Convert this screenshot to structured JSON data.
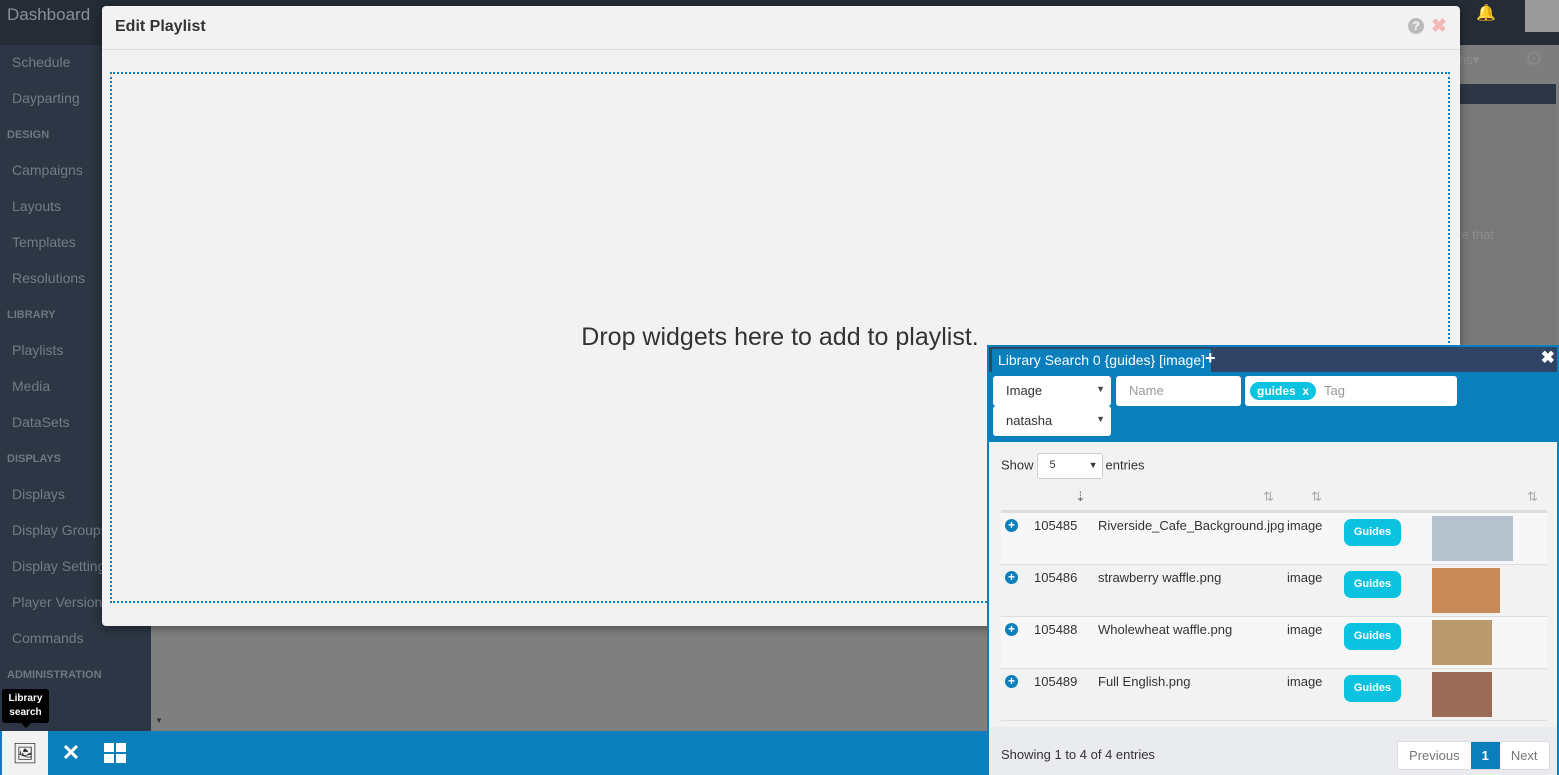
{
  "topbar": {
    "brand": "Dashboard"
  },
  "sidebar": {
    "items": [
      {
        "label": "Schedule",
        "type": "item"
      },
      {
        "label": "Dayparting",
        "type": "item"
      },
      {
        "label": "DESIGN",
        "type": "header"
      },
      {
        "label": "Campaigns",
        "type": "item"
      },
      {
        "label": "Layouts",
        "type": "item"
      },
      {
        "label": "Templates",
        "type": "item"
      },
      {
        "label": "Resolutions",
        "type": "item"
      },
      {
        "label": "LIBRARY",
        "type": "header"
      },
      {
        "label": "Playlists",
        "type": "item"
      },
      {
        "label": "Media",
        "type": "item"
      },
      {
        "label": "DataSets",
        "type": "item"
      },
      {
        "label": "DISPLAYS",
        "type": "header"
      },
      {
        "label": "Displays",
        "type": "item"
      },
      {
        "label": "Display Groups",
        "type": "item"
      },
      {
        "label": "Display Settings",
        "type": "item"
      },
      {
        "label": "Player Versions",
        "type": "item"
      },
      {
        "label": "Commands",
        "type": "item"
      },
      {
        "label": "ADMINISTRATION",
        "type": "header"
      }
    ]
  },
  "background": {
    "actions_label": "Actions▾",
    "note_text": "Please note that"
  },
  "modal": {
    "title": "Edit Playlist",
    "drop_text": "Drop widgets here to add to playlist."
  },
  "toolbar": {
    "tooltip": "Library search",
    "buttons": [
      {
        "icon": "library-search-icon"
      },
      {
        "icon": "tools-icon"
      },
      {
        "icon": "grid-icon"
      }
    ]
  },
  "library": {
    "tab_label": "Library Search 0 {guides} [image]",
    "filters": {
      "type": "Image",
      "name_placeholder": "Name",
      "tag_pill": "guides",
      "tag_pill_remove": "x",
      "tag_placeholder": "Tag",
      "owner": "natasha"
    },
    "show_label": "Show",
    "page_size": "5",
    "entries_label": "entries",
    "rows": [
      {
        "id": "105485",
        "name": "Riverside_Cafe_Background.jpg",
        "type": "image",
        "button": "Guides",
        "thumb_color": "#b7c2cf"
      },
      {
        "id": "105486",
        "name": "strawberry waffle.png",
        "type": "image",
        "button": "Guides",
        "thumb_color": "#c98a5a"
      },
      {
        "id": "105488",
        "name": "Wholewheat waffle.png",
        "type": "image",
        "button": "Guides",
        "thumb_color": "#b89a6e"
      },
      {
        "id": "105489",
        "name": "Full English.png",
        "type": "image",
        "button": "Guides",
        "thumb_color": "#9b6b58"
      }
    ],
    "footer": {
      "summary": "Showing 1 to 4 of 4 entries",
      "previous": "Previous",
      "page": "1",
      "next": "Next"
    }
  },
  "colors": {
    "accent": "#0a7fbb",
    "pill": "#0bc3e0",
    "sidebar": "#2c3644"
  }
}
